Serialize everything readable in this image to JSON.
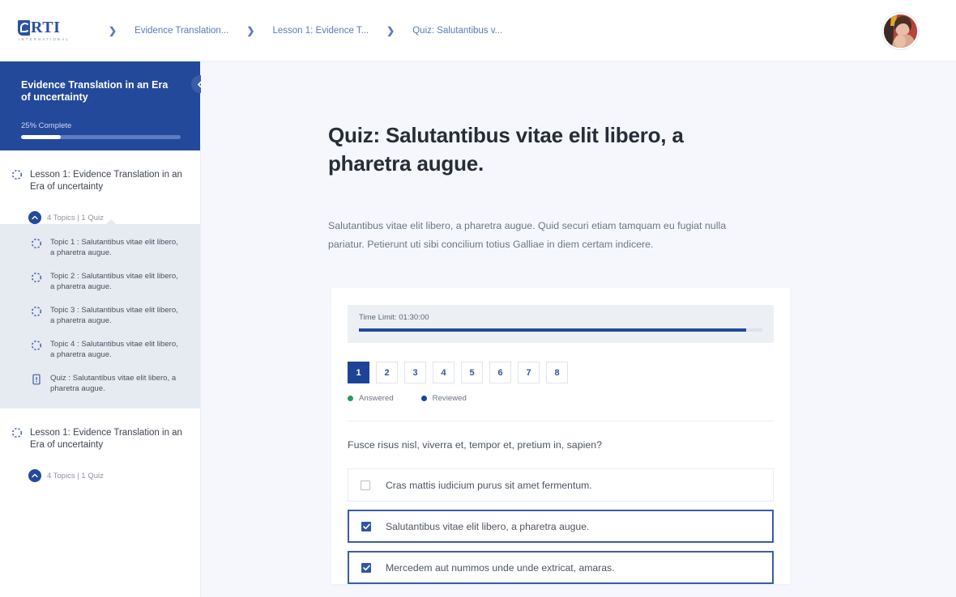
{
  "brand": {
    "logo_text": "RTI",
    "logo_subtext": "INTERNATIONAL",
    "primary": "#23499b",
    "link": "#5b79bd",
    "answered_color": "#1a9e62",
    "reviewed_color": "#1d4397"
  },
  "header": {
    "breadcrumbs": [
      {
        "label": "Evidence Translation..."
      },
      {
        "label": "Lesson 1: Evidence T..."
      },
      {
        "label": "Quiz: Salutantibus v..."
      }
    ],
    "separator": "❯",
    "avatar_name": "user-avatar"
  },
  "sidebar": {
    "course_title": "Evidence Translation in an Era of uncertainty",
    "progress_label": "25% Complete",
    "progress_percent": 25,
    "collapse_icon": "chevron-left-icon",
    "lessons": [
      {
        "title": "Lesson 1: Evidence Translation in an Era of uncertainty",
        "meta": "4 Topics  |  1 Quiz",
        "expanded": true,
        "items": [
          {
            "label": "Topic 1 : Salutantibus vitae elit libero, a pharetra augue.",
            "icon": "topic-circle-icon"
          },
          {
            "label": "Topic 2 : Salutantibus vitae elit libero, a pharetra augue.",
            "icon": "topic-circle-icon"
          },
          {
            "label": "Topic 3 : Salutantibus vitae elit libero, a pharetra augue.",
            "icon": "topic-circle-icon"
          },
          {
            "label": "Topic 4 : Salutantibus vitae elit libero, a pharetra augue.",
            "icon": "topic-circle-icon"
          },
          {
            "label": "Quiz : Salutantibus vitae elit libero, a pharetra augue.",
            "icon": "quiz-doc-icon"
          }
        ]
      },
      {
        "title": "Lesson 1: Evidence Translation in an Era of uncertainty",
        "meta": "4 Topics  |  1 Quiz",
        "expanded": false,
        "items": []
      }
    ]
  },
  "main": {
    "page_title": "Quiz: Salutantibus vitae elit libero, a pharetra augue.",
    "intro": "Salutantibus vitae elit libero, a pharetra augue. Quid securi etiam tamquam eu fugiat nulla pariatur. Petierunt uti sibi concilium totius Galliae in diem certam indicere.",
    "quiz": {
      "time_limit_label": "Time Limit: 01:30:00",
      "time_progress_percent": 96,
      "pages": [
        "1",
        "2",
        "3",
        "4",
        "5",
        "6",
        "7",
        "8"
      ],
      "active_page": "1",
      "legend": [
        {
          "label": "Answered",
          "color": "#1a9e62"
        },
        {
          "label": "Reviewed",
          "color": "#1d4397"
        }
      ],
      "question": "Fusce risus nisl, viverra et, tempor et, pretium in, sapien?",
      "options": [
        {
          "label": "Cras mattis iudicium purus sit amet fermentum.",
          "selected": false
        },
        {
          "label": "Salutantibus vitae elit libero, a pharetra augue.",
          "selected": true
        },
        {
          "label": "Mercedem aut nummos unde unde extricat, amaras.",
          "selected": true
        }
      ]
    }
  }
}
